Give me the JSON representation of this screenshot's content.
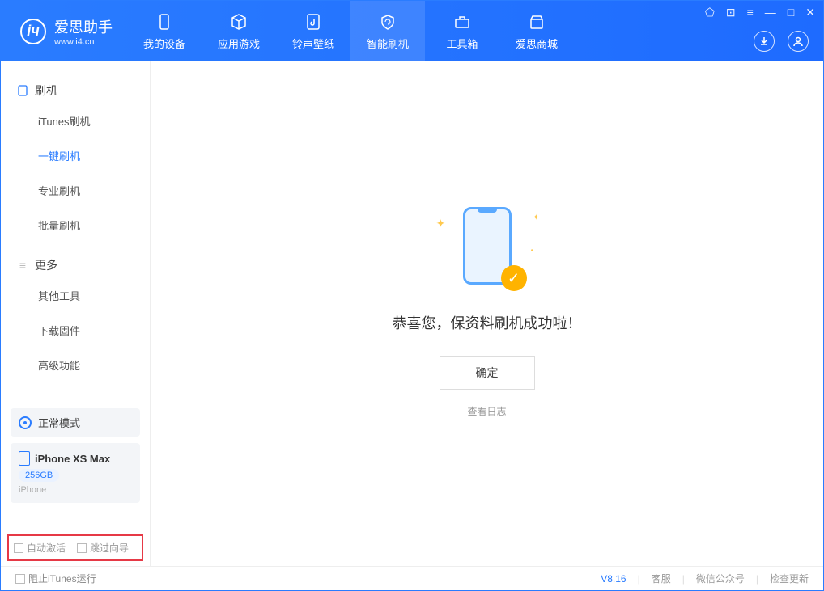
{
  "app": {
    "title": "爱思助手",
    "site": "www.i4.cn"
  },
  "nav": {
    "items": [
      {
        "label": "我的设备"
      },
      {
        "label": "应用游戏"
      },
      {
        "label": "铃声壁纸"
      },
      {
        "label": "智能刷机"
      },
      {
        "label": "工具箱"
      },
      {
        "label": "爱思商城"
      }
    ]
  },
  "sidebar": {
    "section1": {
      "title": "刷机",
      "items": [
        "iTunes刷机",
        "一键刷机",
        "专业刷机",
        "批量刷机"
      ]
    },
    "section2": {
      "title": "更多",
      "items": [
        "其他工具",
        "下载固件",
        "高级功能"
      ]
    }
  },
  "device": {
    "mode": "正常模式",
    "name": "iPhone XS Max",
    "storage": "256GB",
    "type": "iPhone"
  },
  "bottom_checks": {
    "auto_activate": "自动激活",
    "skip_guide": "跳过向导"
  },
  "main": {
    "success_text": "恭喜您，保资料刷机成功啦！",
    "ok": "确定",
    "view_log": "查看日志"
  },
  "status": {
    "block_itunes": "阻止iTunes运行",
    "version": "V8.16",
    "support": "客服",
    "wechat": "微信公众号",
    "update": "检查更新"
  }
}
